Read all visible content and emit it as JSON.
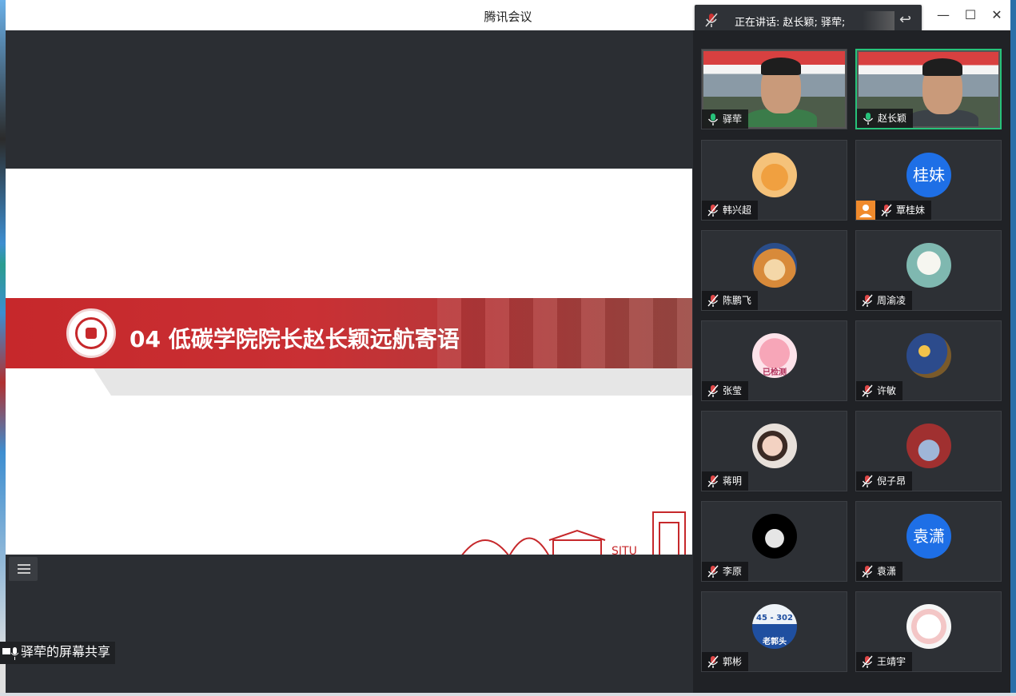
{
  "window": {
    "title": "腾讯会议"
  },
  "speaking": {
    "text": "正在讲话: 赵长颖; 驿荦;"
  },
  "slide": {
    "title": "04 低碳学院院长赵长颖远航寄语",
    "skyline_text": "SJTU"
  },
  "share": {
    "label": "驿荦的屏幕共享"
  },
  "participants": [
    {
      "name": "驿荦",
      "type": "video",
      "mic": "on",
      "col": 0,
      "row": 0
    },
    {
      "name": "赵长颖",
      "type": "video",
      "mic": "on",
      "col": 1,
      "row": 0,
      "active": true
    },
    {
      "name": "韩兴超",
      "type": "avatar",
      "avatar": "tiger",
      "mic": "off",
      "col": 0,
      "row": 1
    },
    {
      "name": "覃桂妹",
      "type": "avatar",
      "avatar_text": "桂妹",
      "mic": "off",
      "host": true,
      "col": 1,
      "row": 1
    },
    {
      "name": "陈鹏飞",
      "type": "avatar",
      "avatar": "dog",
      "mic": "off",
      "col": 0,
      "row": 2
    },
    {
      "name": "周渝凌",
      "type": "avatar",
      "avatar": "cartoon",
      "mic": "off",
      "col": 1,
      "row": 2
    },
    {
      "name": "张莹",
      "type": "avatar",
      "avatar": "pig",
      "avatar_caption": "已检测",
      "mic": "off",
      "col": 0,
      "row": 3
    },
    {
      "name": "许敏",
      "type": "avatar",
      "avatar": "starry-night",
      "mic": "off",
      "col": 1,
      "row": 3
    },
    {
      "name": "蒋明",
      "type": "avatar",
      "avatar": "child",
      "mic": "off",
      "col": 0,
      "row": 4
    },
    {
      "name": "倪子昂",
      "type": "avatar",
      "avatar": "crowd",
      "mic": "off",
      "col": 1,
      "row": 4
    },
    {
      "name": "李原",
      "type": "avatar",
      "avatar": "moon",
      "mic": "off",
      "col": 0,
      "row": 5
    },
    {
      "name": "袁潇",
      "type": "avatar",
      "avatar_text": "袁潇",
      "mic": "off",
      "col": 1,
      "row": 5
    },
    {
      "name": "郭彬",
      "type": "avatar",
      "avatar": "sign",
      "avatar_caption": "45 - 302",
      "avatar_caption2": "老郭头",
      "mic": "off",
      "col": 0,
      "row": 6
    },
    {
      "name": "王靖宇",
      "type": "avatar",
      "avatar": "bear",
      "mic": "off",
      "col": 1,
      "row": 6
    }
  ],
  "colors": {
    "accent_red": "#c6282b",
    "mic_green": "#27c27a",
    "avatar_blue": "#1e6fe6"
  }
}
